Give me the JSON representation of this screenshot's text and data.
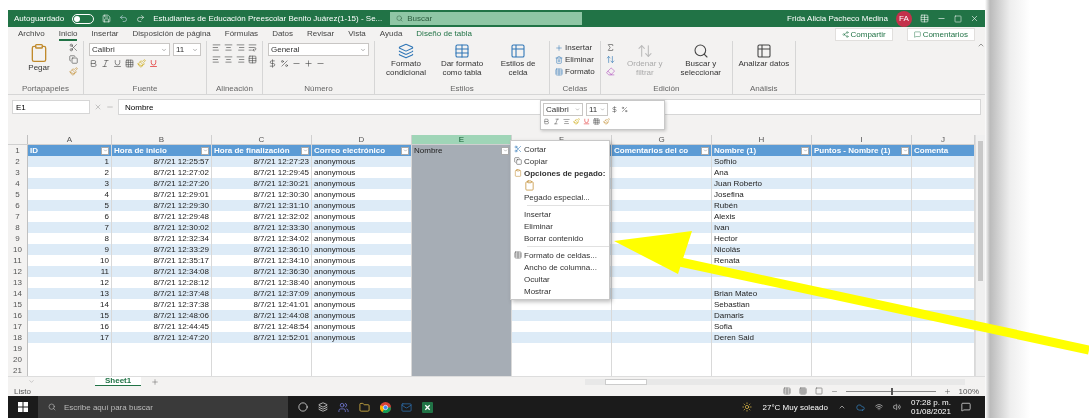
{
  "title_bar": {
    "autosave_label": "Autoguardado",
    "autosave_on": false,
    "title": "Estudiantes de Educación Preescolar Benito Juárez(1-15) - Se...",
    "search_placeholder": "Buscar",
    "user": "Frida Alicia Pacheco Medina",
    "avatar": "FA"
  },
  "ribbon_tabs": [
    {
      "label": "Archivo",
      "selected": false
    },
    {
      "label": "Inicio",
      "selected": true
    },
    {
      "label": "Insertar",
      "selected": false
    },
    {
      "label": "Disposición de página",
      "selected": false
    },
    {
      "label": "Fórmulas",
      "selected": false
    },
    {
      "label": "Datos",
      "selected": false
    },
    {
      "label": "Revisar",
      "selected": false
    },
    {
      "label": "Vista",
      "selected": false
    },
    {
      "label": "Ayuda",
      "selected": false
    },
    {
      "label": "Diseño de tabla",
      "selected": false,
      "kind": "contextual"
    }
  ],
  "share_button": "Compartir",
  "comments_button": "Comentarios",
  "ribbon_groups": [
    {
      "kind": "clipboard",
      "label": "Portapapeles",
      "buttons": [
        "Pegar"
      ]
    },
    {
      "kind": "font",
      "label": "Fuente",
      "font": "Calibri",
      "size": "11"
    },
    {
      "kind": "alignment",
      "label": "Alineación"
    },
    {
      "kind": "number",
      "label": "Número",
      "format": "General"
    },
    {
      "kind": "styles",
      "label": "Estilos",
      "buttons": [
        "Formato condicional",
        "Dar formato como tabla",
        "Estilos de celda"
      ]
    },
    {
      "kind": "cells",
      "label": "Celdas",
      "buttons": [
        "Insertar",
        "Eliminar",
        "Formato"
      ]
    },
    {
      "kind": "editing",
      "label": "Edición",
      "buttons": [
        "Ordenar y filtrar",
        "Buscar y seleccionar"
      ]
    },
    {
      "kind": "analysis",
      "label": "Análisis",
      "buttons": [
        "Analizar datos"
      ]
    }
  ],
  "formula_bar": {
    "name_box": "E1",
    "value": "Nombre"
  },
  "mini_toolbar": {
    "font": "Calibri",
    "size": "11"
  },
  "columns": [
    {
      "letter": "A",
      "header": "ID",
      "selected": false
    },
    {
      "letter": "B",
      "header": "Hora de inicio",
      "selected": false
    },
    {
      "letter": "C",
      "header": "Hora de finalización",
      "selected": false
    },
    {
      "letter": "D",
      "header": "Correo electrónico",
      "selected": false
    },
    {
      "letter": "E",
      "header": "Nombre",
      "selected": true
    },
    {
      "letter": "F",
      "selected": false
    },
    {
      "letter": "G",
      "header": "Comentarios del co",
      "selected": false
    },
    {
      "letter": "H",
      "header": "Nombre (1)",
      "selected": false
    },
    {
      "letter": "I",
      "header": "Puntos - Nombre (1)",
      "selected": false
    },
    {
      "letter": "J",
      "header": "Comenta",
      "selected": false
    }
  ],
  "header_row_number": "1",
  "rows": [
    {
      "num": "2",
      "id": "1",
      "start": "8/7/21 12:25:57",
      "end": "8/7/21 12:27:23",
      "email": "anonymous",
      "name": "Sofhio"
    },
    {
      "num": "3",
      "id": "2",
      "start": "8/7/21 12:27:02",
      "end": "8/7/21 12:29:45",
      "email": "anonymous",
      "name": "Ana"
    },
    {
      "num": "4",
      "id": "3",
      "start": "8/7/21 12:27:20",
      "end": "8/7/21 12:30:21",
      "email": "anonymous",
      "name": "Juan Roberto"
    },
    {
      "num": "5",
      "id": "4",
      "start": "8/7/21 12:29:01",
      "end": "8/7/21 12:30:30",
      "email": "anonymous",
      "name": "Josefina"
    },
    {
      "num": "6",
      "id": "5",
      "start": "8/7/21 12:29:30",
      "end": "8/7/21 12:31:10",
      "email": "anonymous",
      "name": "Rubén"
    },
    {
      "num": "7",
      "id": "6",
      "start": "8/7/21 12:29:48",
      "end": "8/7/21 12:32:02",
      "email": "anonymous",
      "name": "Alexis"
    },
    {
      "num": "8",
      "id": "7",
      "start": "8/7/21 12:30:02",
      "end": "8/7/21 12:33:30",
      "email": "anonymous",
      "name": "Ivan"
    },
    {
      "num": "9",
      "id": "8",
      "start": "8/7/21 12:32:34",
      "end": "8/7/21 12:34:02",
      "email": "anonymous",
      "name": "Hector"
    },
    {
      "num": "10",
      "id": "9",
      "start": "8/7/21 12:33:29",
      "end": "8/7/21 12:36:10",
      "email": "anonymous",
      "name": "Nicolás"
    },
    {
      "num": "11",
      "id": "10",
      "start": "8/7/21 12:35:17",
      "end": "8/7/21 12:34:10",
      "email": "anonymous",
      "name": "Renata"
    },
    {
      "num": "12",
      "id": "11",
      "start": "8/7/21 12:34:08",
      "end": "8/7/21 12:36:30",
      "email": "anonymous"
    },
    {
      "num": "13",
      "id": "12",
      "start": "8/7/21 12:28:12",
      "end": "8/7/21 12:38:40",
      "email": "anonymous"
    },
    {
      "num": "14",
      "id": "13",
      "start": "8/7/21 12:37:48",
      "end": "8/7/21 12:37:09",
      "email": "anonymous",
      "name": "Brian Mateo"
    },
    {
      "num": "15",
      "id": "14",
      "start": "8/7/21 12:37:38",
      "end": "8/7/21 12:41:01",
      "email": "anonymous",
      "name": "Sebastian"
    },
    {
      "num": "16",
      "id": "15",
      "start": "8/7/21 12:48:06",
      "end": "8/7/21 12:44:08",
      "email": "anonymous",
      "name": "Damaris"
    },
    {
      "num": "17",
      "id": "16",
      "start": "8/7/21 12:44:45",
      "end": "8/7/21 12:48:54",
      "email": "anonymous",
      "name": "Sofia"
    },
    {
      "num": "18",
      "id": "17",
      "start": "8/7/21 12:47:20",
      "end": "8/7/21 12:52:01",
      "email": "anonymous",
      "name": "Deren Said"
    }
  ],
  "empty_rows": [
    "19",
    "20",
    "21"
  ],
  "context_menu": {
    "groups": [
      [
        {
          "kind": "cut",
          "label": "Cortar"
        },
        {
          "kind": "copy",
          "label": "Copiar"
        },
        {
          "kind": "paste-heading",
          "label": "Opciones de pegado:"
        },
        {
          "kind": "paste-option"
        },
        {
          "kind": "plain",
          "label": "Pegado especial..."
        }
      ],
      [
        {
          "kind": "plain",
          "label": "Insertar"
        },
        {
          "kind": "plain",
          "label": "Eliminar"
        },
        {
          "kind": "plain",
          "label": "Borrar contenido"
        }
      ],
      [
        {
          "kind": "format",
          "label": "Formato de celdas..."
        },
        {
          "kind": "plain",
          "label": "Ancho de columna..."
        },
        {
          "kind": "plain",
          "label": "Ocultar"
        },
        {
          "kind": "plain",
          "label": "Mostrar"
        }
      ]
    ]
  },
  "sheet_tabs": [
    {
      "label": "Sheet1",
      "selected": true
    }
  ],
  "status_bar": {
    "status": "Listo",
    "zoom": "100%",
    "zoom_slider": {
      "level": 0.5
    }
  },
  "taskbar": {
    "search_placeholder": "Escribe aquí para buscar",
    "weather": "27°C  Muy soleado",
    "time": "07:28 p. m.",
    "date": "01/08/2021"
  }
}
